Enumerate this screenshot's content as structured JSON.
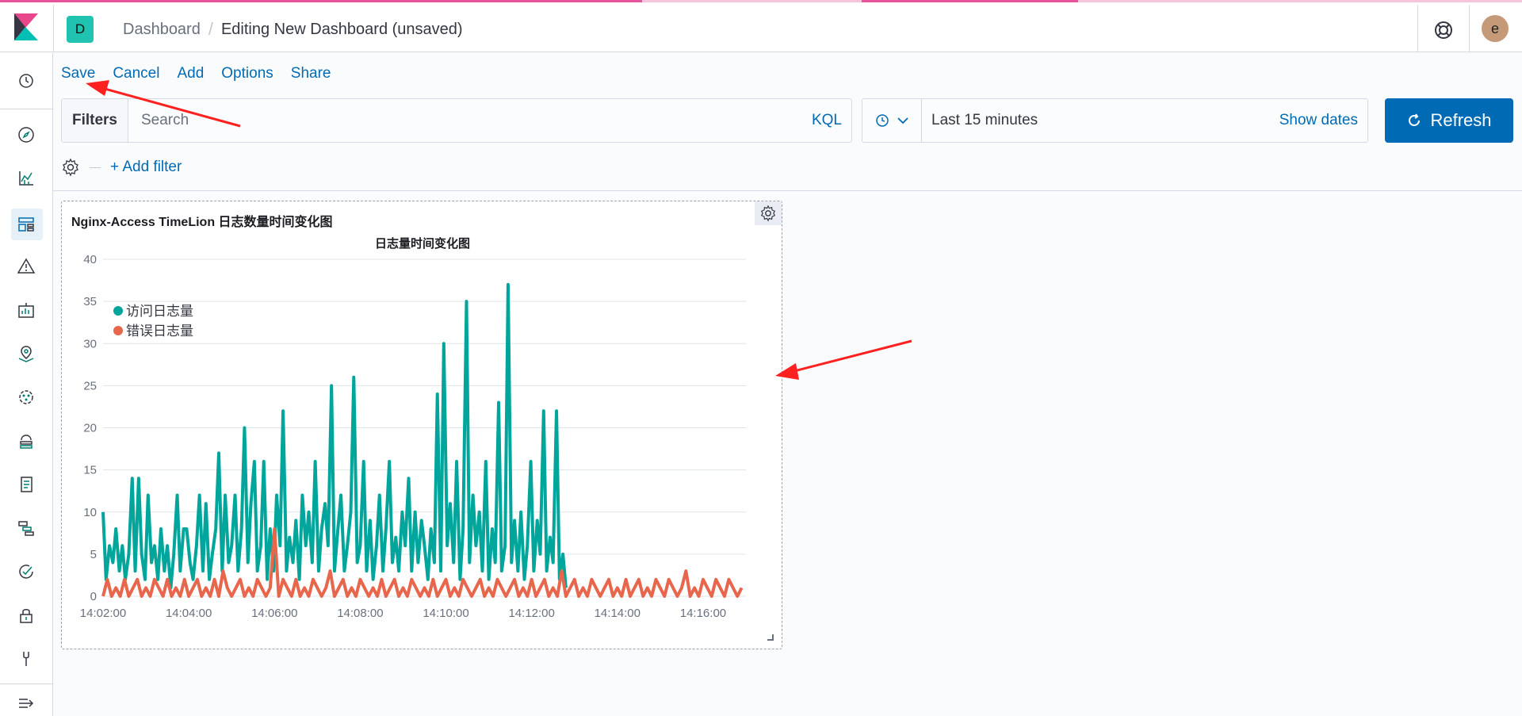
{
  "header": {
    "space_initial": "D",
    "breadcrumb_root": "Dashboard",
    "breadcrumb_separator": "/",
    "breadcrumb_current": "Editing New Dashboard (unsaved)",
    "user_initial": "e"
  },
  "sidebar": {
    "items": [
      {
        "icon": "clock-icon",
        "label": "Recently viewed"
      },
      {
        "icon": "compass-icon",
        "label": "Discover"
      },
      {
        "icon": "visualize-icon",
        "label": "Visualize"
      },
      {
        "icon": "dashboard-icon",
        "label": "Dashboard"
      },
      {
        "icon": "alert-icon",
        "label": "Alerting"
      },
      {
        "icon": "canvas-icon",
        "label": "Canvas"
      },
      {
        "icon": "maps-icon",
        "label": "Maps"
      },
      {
        "icon": "ml-icon",
        "label": "Machine Learning"
      },
      {
        "icon": "infra-icon",
        "label": "Infrastructure"
      },
      {
        "icon": "logs-icon",
        "label": "Logs"
      },
      {
        "icon": "apm-icon",
        "label": "APM"
      },
      {
        "icon": "uptime-icon",
        "label": "Uptime"
      },
      {
        "icon": "security-icon",
        "label": "SIEM"
      },
      {
        "icon": "devtools-icon",
        "label": "Dev Tools"
      },
      {
        "icon": "collapse-icon",
        "label": "Collapse"
      }
    ]
  },
  "topnav": {
    "save": "Save",
    "cancel": "Cancel",
    "add": "Add",
    "options": "Options",
    "share": "Share"
  },
  "query": {
    "filters_label": "Filters",
    "search_placeholder": "Search",
    "language": "KQL"
  },
  "time": {
    "range": "Last 15 minutes",
    "show_dates": "Show dates",
    "refresh": "Refresh"
  },
  "filter_row": {
    "add_filter": "+ Add filter"
  },
  "panel": {
    "title": "Nginx-Access TimeLion 日志数量时间变化图"
  },
  "colors": {
    "accent": "#006bb4",
    "series_access": "#00a69b",
    "series_error": "#e7664c",
    "annotation": "#ff2020"
  },
  "chart_data": {
    "type": "line",
    "title": "日志量时间变化图",
    "xlabel": "",
    "ylabel": "",
    "x_ticks": [
      "14:02:00",
      "14:04:00",
      "14:06:00",
      "14:08:00",
      "14:10:00",
      "14:12:00",
      "14:14:00",
      "14:16:00"
    ],
    "y_ticks": [
      0,
      5,
      10,
      15,
      20,
      25,
      30,
      35,
      40
    ],
    "ylim": [
      0,
      40
    ],
    "xlim_minutes": [
      14.0,
      29.0
    ],
    "legend_position": "top-left",
    "series": [
      {
        "name": "访问日志量",
        "color": "#00a69b",
        "x_minutes": [
          14.0,
          14.07,
          14.15,
          14.23,
          14.3,
          14.38,
          14.45,
          14.52,
          14.6,
          14.68,
          14.75,
          14.83,
          14.9,
          14.98,
          15.05,
          15.13,
          15.2,
          15.28,
          15.35,
          15.43,
          15.5,
          15.58,
          15.65,
          15.73,
          15.8,
          15.88,
          15.95,
          16.03,
          16.1,
          16.18,
          16.25,
          16.33,
          16.4,
          16.48,
          16.55,
          16.63,
          16.7,
          16.78,
          16.85,
          16.93,
          17.0,
          17.08,
          17.15,
          17.23,
          17.3,
          17.38,
          17.45,
          17.53,
          17.6,
          17.68,
          17.75,
          17.83,
          17.9,
          17.98,
          18.05,
          18.13,
          18.2,
          18.28,
          18.35,
          18.43,
          18.5,
          18.58,
          18.65,
          18.73,
          18.8,
          18.88,
          18.95,
          19.03,
          19.1,
          19.18,
          19.25,
          19.33,
          19.4,
          19.48,
          19.55,
          19.63,
          19.7,
          19.78,
          19.85,
          19.93,
          20.0,
          20.08,
          20.15,
          20.23,
          20.3,
          20.38,
          20.45,
          20.53,
          20.6,
          20.68,
          20.75,
          20.83,
          20.9,
          20.98,
          21.05,
          21.13,
          21.2,
          21.28,
          21.35,
          21.43,
          21.5,
          21.58,
          21.65,
          21.73,
          21.8,
          21.88,
          21.95,
          22.03,
          22.1,
          22.18,
          22.25,
          22.33,
          22.4,
          22.48,
          22.55,
          22.63,
          22.7,
          22.78,
          22.85,
          22.93,
          23.0,
          23.08,
          23.15,
          23.23,
          23.3,
          23.38,
          23.45,
          23.53,
          23.6,
          23.68,
          23.75,
          23.83,
          23.9,
          23.98,
          24.05,
          24.13,
          24.2,
          24.28,
          24.35,
          24.43,
          24.5,
          24.58,
          24.65,
          24.73,
          24.8,
          24.88,
          24.95,
          25.03,
          25.1,
          25.18,
          25.25,
          25.33,
          25.4,
          25.48,
          25.55,
          25.63,
          25.7,
          25.78,
          25.85,
          25.93,
          26.0,
          26.08,
          26.15,
          26.23,
          26.3,
          26.38,
          26.45,
          26.53,
          26.6,
          26.68,
          26.75,
          26.83,
          26.9,
          26.98,
          27.05,
          27.13,
          27.2,
          27.28,
          27.35,
          27.43,
          27.5,
          27.58,
          27.65,
          27.73,
          27.8,
          27.88,
          27.95,
          28.03,
          28.1,
          28.18,
          28.25,
          28.33,
          28.4,
          28.48,
          28.55,
          28.63,
          28.7,
          28.78,
          28.85,
          28.93
        ],
        "values": [
          10,
          2,
          6,
          4,
          8,
          3,
          6,
          2,
          5,
          14,
          3,
          14,
          5,
          2,
          12,
          4,
          6,
          2,
          8,
          3,
          6,
          1,
          5,
          12,
          3,
          8,
          8,
          4,
          2,
          6,
          12,
          3,
          11,
          2,
          5,
          8,
          17,
          3,
          12,
          4,
          6,
          12,
          3,
          8,
          20,
          4,
          11,
          16,
          3,
          6,
          16,
          2,
          8,
          3,
          12,
          6,
          22,
          3,
          7,
          4,
          9,
          2,
          12,
          6,
          10,
          4,
          16,
          3,
          8,
          11,
          6,
          25,
          3,
          8,
          12,
          3,
          6,
          10,
          26,
          4,
          6,
          16,
          3,
          9,
          2,
          6,
          12,
          3,
          8,
          16,
          4,
          7,
          3,
          10,
          6,
          14,
          3,
          10,
          4,
          9,
          6,
          2,
          8,
          4,
          24,
          3,
          30,
          6,
          11,
          4,
          16,
          2,
          8,
          35,
          4,
          12,
          6,
          10,
          3,
          16,
          2,
          8,
          4,
          23,
          3,
          6,
          37,
          4,
          9,
          3,
          10,
          2,
          6,
          16,
          3,
          9,
          5,
          22,
          3,
          7,
          4,
          22,
          2,
          5,
          1
        ]
      },
      {
        "name": "错误日志量",
        "color": "#e7664c",
        "x_minutes": [
          14.0,
          14.1,
          14.2,
          14.3,
          14.4,
          14.5,
          14.6,
          14.7,
          14.8,
          14.9,
          15.0,
          15.1,
          15.2,
          15.3,
          15.4,
          15.5,
          15.6,
          15.7,
          15.8,
          15.9,
          16.0,
          16.1,
          16.2,
          16.3,
          16.4,
          16.5,
          16.6,
          16.7,
          16.8,
          16.9,
          17.0,
          17.1,
          17.2,
          17.3,
          17.4,
          17.5,
          17.6,
          17.7,
          17.8,
          17.9,
          18.0,
          18.1,
          18.2,
          18.3,
          18.4,
          18.5,
          18.6,
          18.7,
          18.8,
          18.9,
          19.0,
          19.1,
          19.2,
          19.3,
          19.4,
          19.5,
          19.6,
          19.7,
          19.8,
          19.9,
          20.0,
          20.1,
          20.2,
          20.3,
          20.4,
          20.5,
          20.6,
          20.7,
          20.8,
          20.9,
          21.0,
          21.1,
          21.2,
          21.3,
          21.4,
          21.5,
          21.6,
          21.7,
          21.8,
          21.9,
          22.0,
          22.1,
          22.2,
          22.3,
          22.4,
          22.5,
          22.6,
          22.7,
          22.8,
          22.9,
          23.0,
          23.1,
          23.2,
          23.3,
          23.4,
          23.5,
          23.6,
          23.7,
          23.8,
          23.9,
          24.0,
          24.1,
          24.2,
          24.3,
          24.4,
          24.5,
          24.6,
          24.7,
          24.8,
          24.9,
          25.0,
          25.1,
          25.2,
          25.3,
          25.4,
          25.5,
          25.6,
          25.7,
          25.8,
          25.9,
          26.0,
          26.1,
          26.2,
          26.3,
          26.4,
          26.5,
          26.6,
          26.7,
          26.8,
          26.9,
          27.0,
          27.1,
          27.2,
          27.3,
          27.4,
          27.5,
          27.6,
          27.7,
          27.8,
          27.9,
          28.0,
          28.1,
          28.2,
          28.3,
          28.4,
          28.5,
          28.6,
          28.7,
          28.8,
          28.9
        ],
        "values": [
          0,
          2,
          0,
          1,
          0,
          2,
          0,
          1,
          2,
          0,
          1,
          0,
          2,
          1,
          0,
          2,
          0,
          1,
          0,
          2,
          0,
          1,
          2,
          0,
          1,
          0,
          2,
          0,
          3,
          1,
          0,
          1,
          2,
          0,
          1,
          0,
          2,
          1,
          0,
          1,
          8,
          0,
          2,
          1,
          0,
          2,
          0,
          1,
          0,
          2,
          1,
          0,
          1,
          3,
          0,
          1,
          2,
          0,
          1,
          0,
          2,
          1,
          0,
          1,
          0,
          2,
          0,
          1,
          2,
          0,
          1,
          0,
          2,
          1,
          0,
          1,
          0,
          2,
          0,
          1,
          2,
          0,
          1,
          0,
          2,
          1,
          0,
          1,
          2,
          0,
          1,
          0,
          2,
          1,
          0,
          1,
          2,
          0,
          1,
          0,
          2,
          0,
          1,
          2,
          0,
          1,
          0,
          3,
          0,
          1,
          2,
          0,
          1,
          0,
          2,
          1,
          0,
          1,
          2,
          0,
          1,
          0,
          2,
          0,
          1,
          2,
          0,
          1,
          0,
          2,
          1,
          0,
          2,
          1,
          0,
          1,
          3,
          0,
          1,
          0,
          2,
          1,
          0,
          2,
          1,
          0,
          2,
          1,
          0,
          1
        ]
      }
    ]
  }
}
